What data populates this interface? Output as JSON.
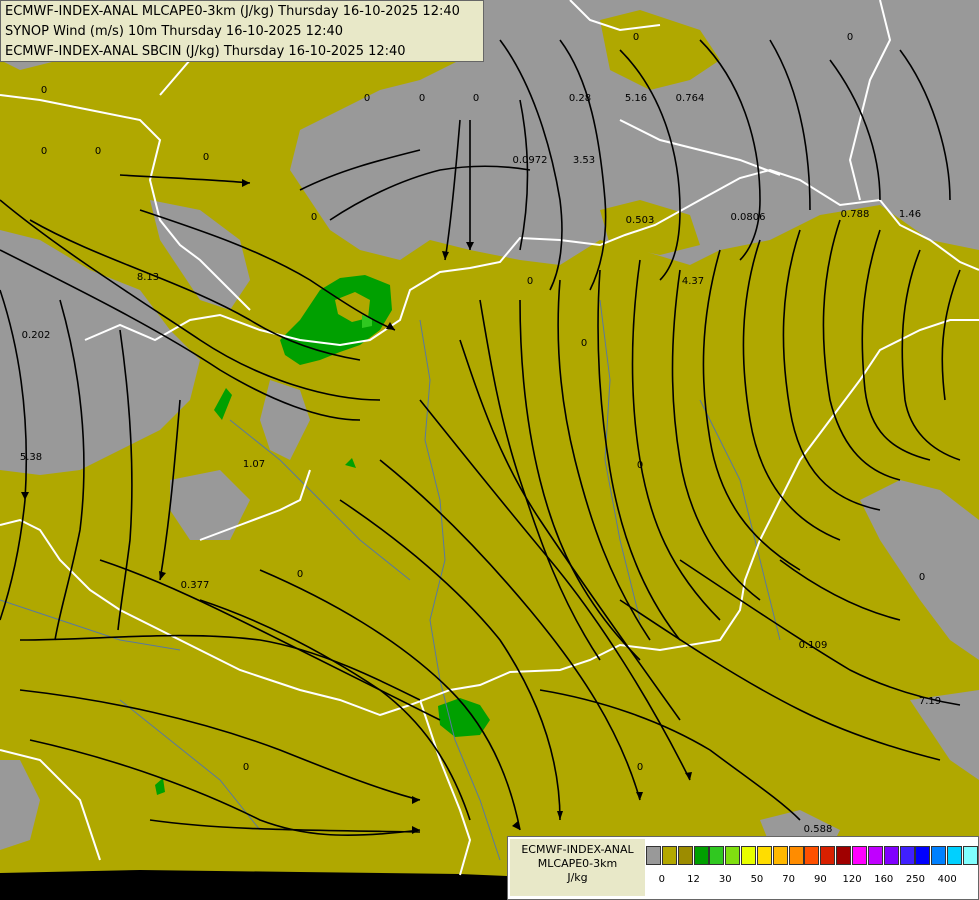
{
  "title_lines": [
    "ECMWF-INDEX-ANAL MLCAPE0-3km (J/kg) Thursday 16-10-2025 12:40",
    "SYNOP Wind (m/s) 10m Thursday 16-10-2025 12:40",
    "ECMWF-INDEX-ANAL SBCIN (J/kg) Thursday 16-10-2025 12:40"
  ],
  "legend": {
    "line1": "ECMWF-INDEX-ANAL",
    "line2": "MLCAPE0-3km",
    "units": "J/kg",
    "colors": [
      "#999999",
      "#b3a800",
      "#9c8c00",
      "#00a000",
      "#30c820",
      "#80e010",
      "#e8ff00",
      "#ffdd00",
      "#ffb800",
      "#ff8c00",
      "#ff5000",
      "#d82000",
      "#a00000",
      "#ff00ff",
      "#c000ff",
      "#8000ff",
      "#4020ff",
      "#0000ff",
      "#0080ff",
      "#00d0ff",
      "#80ffff",
      "#ffffff"
    ],
    "ticks": [
      "0",
      "12",
      "30",
      "50",
      "70",
      "90",
      "120",
      "160",
      "250",
      "400"
    ]
  },
  "colors": {
    "no_cape": "#999999",
    "low_cape": "#b0a800",
    "cape_green": "#00a000",
    "bright_green": "#30c820",
    "borders": "#ffffff",
    "rivers": "#5878a0",
    "streamlines": "#000000",
    "outside_domain": "#000000"
  },
  "sbcin_labels": [
    "0",
    "0",
    "0",
    "0",
    "0",
    "0",
    "0",
    "0",
    "0",
    "0",
    "0",
    "0",
    "0",
    "0",
    "0",
    "0",
    "0",
    "0.28",
    "5.16",
    "0.764",
    "0.0972",
    "3.53",
    "0.503",
    "0.0806",
    "0.788",
    "1.46",
    "4.37",
    "8.13",
    "0.202",
    "5.38",
    "1.07",
    "0.377",
    "0.109",
    "7.19",
    "0.588"
  ]
}
